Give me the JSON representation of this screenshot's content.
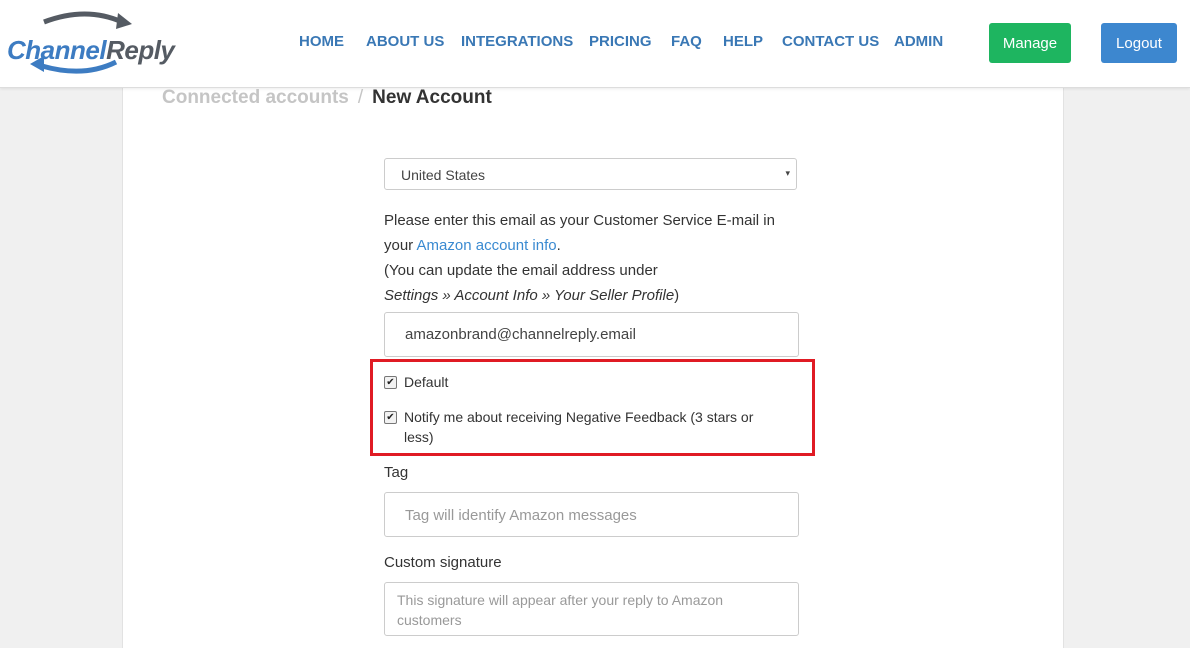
{
  "brand": {
    "part1": "Channel",
    "part2": "Reply"
  },
  "nav": [
    "HOME",
    "ABOUT US",
    "INTEGRATIONS",
    "PRICING",
    "FAQ",
    "HELP",
    "CONTACT US",
    "ADMIN"
  ],
  "buttons": {
    "manage": "Manage",
    "logout": "Logout"
  },
  "breadcrumb": {
    "parent": "Connected accounts",
    "separator": "/",
    "current": "New Account"
  },
  "country_select": {
    "value": "United States",
    "caret": "▾"
  },
  "instructions": {
    "line1": "Please enter this email as your Customer Service E-mail in your",
    "link": "Amazon account info",
    "after_link": ".",
    "line2": "(You can update the email address under",
    "path": "Settings » Account Info » Your Seller Profile",
    "close": ")"
  },
  "email_value": "amazonbrand@channelreply.email",
  "checkboxes": [
    {
      "label": "Default",
      "checked": true
    },
    {
      "label": "Notify me about receiving Negative Feedback (3 stars or",
      "label_line2": "less)",
      "checked": true
    }
  ],
  "tag": {
    "label": "Tag",
    "placeholder": "Tag will identify Amazon messages"
  },
  "signature": {
    "label": "Custom signature",
    "placeholder_line1": "This signature will appear after your reply to Amazon",
    "placeholder_line2": "customers"
  },
  "colors": {
    "highlight": "#e01b24",
    "manage": "#1eb560",
    "logout": "#3d87cf",
    "nav": "#3a78b5"
  }
}
